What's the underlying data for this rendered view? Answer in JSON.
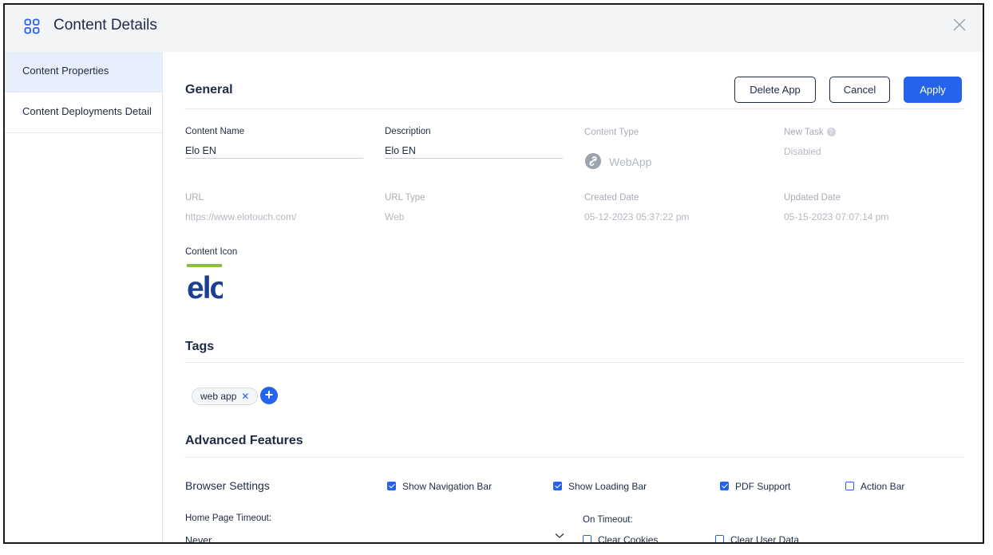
{
  "header": {
    "title": "Content Details"
  },
  "sidebar": {
    "items": [
      {
        "label": "Content Properties"
      },
      {
        "label": "Content Deployments Detail"
      }
    ]
  },
  "general": {
    "section_title": "General",
    "buttons": {
      "delete": "Delete App",
      "cancel": "Cancel",
      "apply": "Apply"
    },
    "fields": {
      "content_name": {
        "label": "Content Name",
        "value": "Elo EN"
      },
      "description": {
        "label": "Description",
        "value": "Elo EN"
      },
      "content_type": {
        "label": "Content Type",
        "value": "WebApp"
      },
      "new_task": {
        "label": "New Task",
        "value": "Disabled"
      },
      "url": {
        "label": "URL",
        "value": "https://www.elotouch.com/"
      },
      "url_type": {
        "label": "URL Type",
        "value": "Web"
      },
      "created_date": {
        "label": "Created Date",
        "value": "05-12-2023 05:37:22 pm"
      },
      "updated_date": {
        "label": "Updated Date",
        "value": "05-15-2023 07:07:14 pm"
      },
      "content_icon": {
        "label": "Content Icon",
        "logo_text": "elo"
      }
    }
  },
  "tags": {
    "section_title": "Tags",
    "items": [
      {
        "label": "web app"
      }
    ]
  },
  "advanced": {
    "section_title": "Advanced Features",
    "browser_settings": {
      "label": "Browser Settings",
      "options": [
        {
          "label": "Show Navigation Bar",
          "checked": true
        },
        {
          "label": "Show Loading Bar",
          "checked": true
        },
        {
          "label": "PDF Support",
          "checked": true
        },
        {
          "label": "Action Bar",
          "checked": false
        }
      ]
    },
    "home_page_timeout": {
      "label": "Home Page Timeout:",
      "value": "Never"
    },
    "on_timeout": {
      "label": "On Timeout:",
      "options": [
        {
          "label": "Clear Cookies",
          "checked": false
        },
        {
          "label": "Clear User Data",
          "checked": false
        }
      ]
    }
  },
  "colors": {
    "accent": "#2563eb",
    "header_bg": "#f3f4f6",
    "active_sidebar_bg": "#e8effc",
    "text": "#1f2a44"
  }
}
